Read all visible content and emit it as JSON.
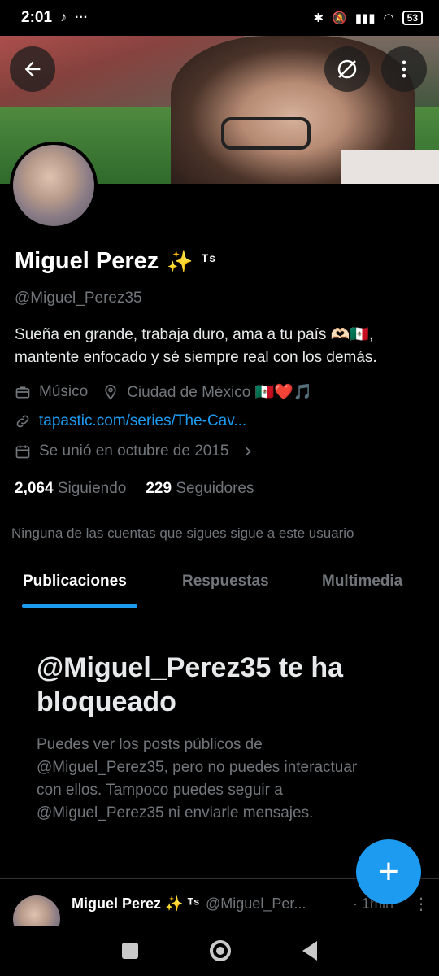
{
  "status_bar": {
    "time": "2:01",
    "battery": "53"
  },
  "profile": {
    "name": "Miguel Perez",
    "name_emoji": "✨",
    "name_suffix": "ᵀˢ",
    "handle": "@Miguel_Perez35",
    "bio_line1": "Sueña en grande, trabaja duro, ama a tu país 🫶🏻🇲🇽,",
    "bio_line2": "mantente enfocado y sé siempre real con los demás.",
    "job": "Músico",
    "location": "Ciudad de México 🇲🇽❤️🎵",
    "website": "tapastic.com/series/The-Cav...",
    "joined": "Se unió en octubre de 2015",
    "following_count": "2,064",
    "following_label": "Siguiendo",
    "followers_count": "229",
    "followers_label": "Seguidores",
    "mutuals_note": "Ninguna de las cuentas que sigues sigue a este usuario"
  },
  "tabs": [
    {
      "label": "Publicaciones",
      "active": true
    },
    {
      "label": "Respuestas",
      "active": false
    },
    {
      "label": "Multimedia",
      "active": false
    }
  ],
  "blocked": {
    "title": "@Miguel_Perez35 te ha bloqueado",
    "message": "Puedes ver los posts públicos de @Miguel_Perez35, pero no puedes interactuar con ellos. Tampoco puedes seguir a @Miguel_Perez35 ni enviarle mensajes."
  },
  "post_preview": {
    "name": "Miguel Perez ✨ ᵀˢ",
    "handle": "@Miguel_Per...",
    "time": "· 1min"
  },
  "fab": {
    "symbol": "+"
  },
  "icons": [
    "back-arrow-icon",
    "grok-icon",
    "more-vertical-icon",
    "briefcase-icon",
    "location-pin-icon",
    "link-icon",
    "calendar-icon",
    "chevron-right-icon",
    "plus-icon"
  ],
  "colors": {
    "accent": "#1d9bf0",
    "background": "#000000",
    "secondary_text": "#71767b"
  }
}
